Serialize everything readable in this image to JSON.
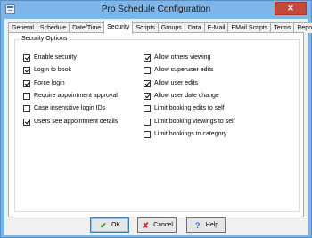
{
  "window": {
    "title": "Pro Schedule Configuration",
    "close_glyph": "✕"
  },
  "tabs": [
    {
      "label": "General",
      "active": false
    },
    {
      "label": "Schedule",
      "active": false
    },
    {
      "label": "Date/Time",
      "active": false
    },
    {
      "label": "Security",
      "active": true
    },
    {
      "label": "Scripts",
      "active": false
    },
    {
      "label": "Groups",
      "active": false
    },
    {
      "label": "Data",
      "active": false
    },
    {
      "label": "E-Mail",
      "active": false
    },
    {
      "label": "EMail Scripts",
      "active": false
    },
    {
      "label": "Terms",
      "active": false
    },
    {
      "label": "Reports",
      "active": false
    }
  ],
  "security": {
    "group_label": "Security Options",
    "left": [
      {
        "label": "Enable security",
        "checked": true
      },
      {
        "label": "Login to book",
        "checked": true
      },
      {
        "label": "Force login",
        "checked": true
      },
      {
        "label": "Require appointment approval",
        "checked": false
      },
      {
        "label": "Case insensitive login IDs",
        "checked": false
      },
      {
        "label": "Users see appointment details",
        "checked": true
      }
    ],
    "right": [
      {
        "label": "Allow others viewing",
        "checked": true
      },
      {
        "label": "Allow superuser edits",
        "checked": false
      },
      {
        "label": "Allow user edits",
        "checked": true
      },
      {
        "label": "Allow user date change",
        "checked": true
      },
      {
        "label": "Limit booking edits to self",
        "checked": false
      },
      {
        "label": "Limit booking viewings to self",
        "checked": false
      },
      {
        "label": "Limit bookings to category",
        "checked": false
      }
    ]
  },
  "buttons": {
    "ok": "OK",
    "cancel": "Cancel",
    "help": "Help"
  },
  "colors": {
    "title_bar": "#7eb6ea",
    "close_button": "#c7463a",
    "ok_icon": "#2e9a2e",
    "cancel_icon": "#c62828",
    "help_icon": "#2f6fc4"
  }
}
